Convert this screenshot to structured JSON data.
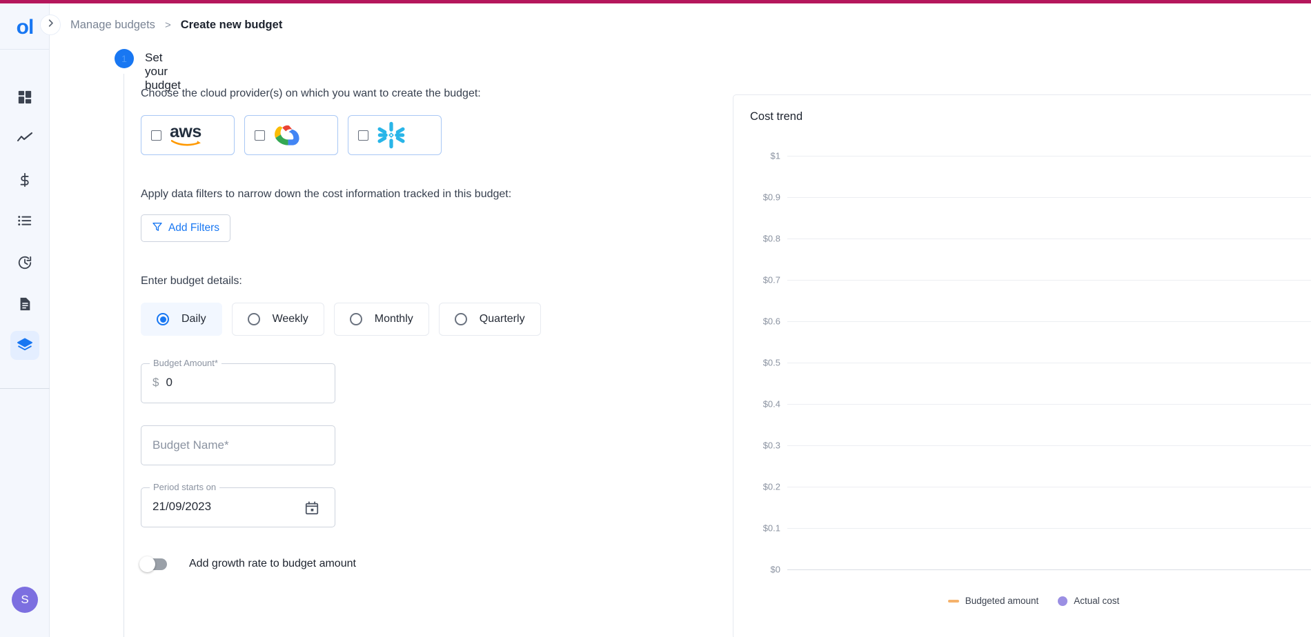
{
  "theme": {
    "accent_bar": "#b5175c",
    "primary_blue": "#1877f2",
    "avatar_purple": "#7c6fe0",
    "budget_line_orange": "#f5b26b",
    "actual_cost_purple": "#9b8fe3",
    "snowflake_cyan": "#29b5e8"
  },
  "rail": {
    "logo": "ol",
    "items": [
      {
        "name": "dashboard-icon",
        "label": "Dashboard",
        "active": false
      },
      {
        "name": "trend-icon",
        "label": "Trends",
        "active": false
      },
      {
        "name": "dollar-icon",
        "label": "Cost",
        "active": false
      },
      {
        "name": "list-icon",
        "label": "Reports",
        "active": false
      },
      {
        "name": "history-icon",
        "label": "History",
        "active": false
      },
      {
        "name": "document-icon",
        "label": "Documents",
        "active": false
      },
      {
        "name": "layers-icon",
        "label": "Budgets",
        "active": true
      }
    ],
    "avatar_initial": "S"
  },
  "breadcrumb": {
    "toggle_icon": "chevron-right-icon",
    "parent": "Manage budgets",
    "separator": ">",
    "current": "Create new budget"
  },
  "step": {
    "number": "1",
    "title": "Set your budget"
  },
  "form": {
    "provider_label": "Choose the cloud provider(s) on which you want to create the budget:",
    "providers": [
      {
        "id": "aws",
        "label": "aws",
        "checked": false
      },
      {
        "id": "gcp",
        "label": "Google Cloud",
        "checked": false
      },
      {
        "id": "snowflake",
        "label": "Snowflake",
        "checked": false
      }
    ],
    "filters_label": "Apply data filters to narrow down the cost information tracked in this budget:",
    "add_filters_button": "Add Filters",
    "details_label": "Enter budget details:",
    "periods": [
      {
        "label": "Daily",
        "selected": true
      },
      {
        "label": "Weekly",
        "selected": false
      },
      {
        "label": "Monthly",
        "selected": false
      },
      {
        "label": "Quarterly",
        "selected": false
      }
    ],
    "budget_amount": {
      "legend": "Budget Amount*",
      "currency_symbol": "$",
      "value": "0"
    },
    "budget_name": {
      "placeholder": "Budget Name*",
      "value": ""
    },
    "period_start": {
      "legend": "Period starts on",
      "value": "21/09/2023",
      "icon": "calendar-icon"
    },
    "growth_toggle": {
      "label": "Add growth rate to budget amount",
      "on": false
    }
  },
  "chart_data": {
    "type": "line",
    "title": "Cost trend",
    "xlabel": "",
    "ylabel": "",
    "ylim": [
      0,
      1
    ],
    "grid": true,
    "legend_position": "bottom",
    "y_ticks": [
      "$1",
      "$0.9",
      "$0.8",
      "$0.7",
      "$0.6",
      "$0.5",
      "$0.4",
      "$0.3",
      "$0.2",
      "$0.1",
      "$0"
    ],
    "y_values": [
      1,
      0.9,
      0.8,
      0.7,
      0.6,
      0.5,
      0.4,
      0.3,
      0.2,
      0.1,
      0
    ],
    "categories": [],
    "series": [
      {
        "name": "Budgeted amount",
        "color": "#f5b26b",
        "marker": "line",
        "values": []
      },
      {
        "name": "Actual cost",
        "color": "#9b8fe3",
        "marker": "circle",
        "values": []
      }
    ]
  }
}
